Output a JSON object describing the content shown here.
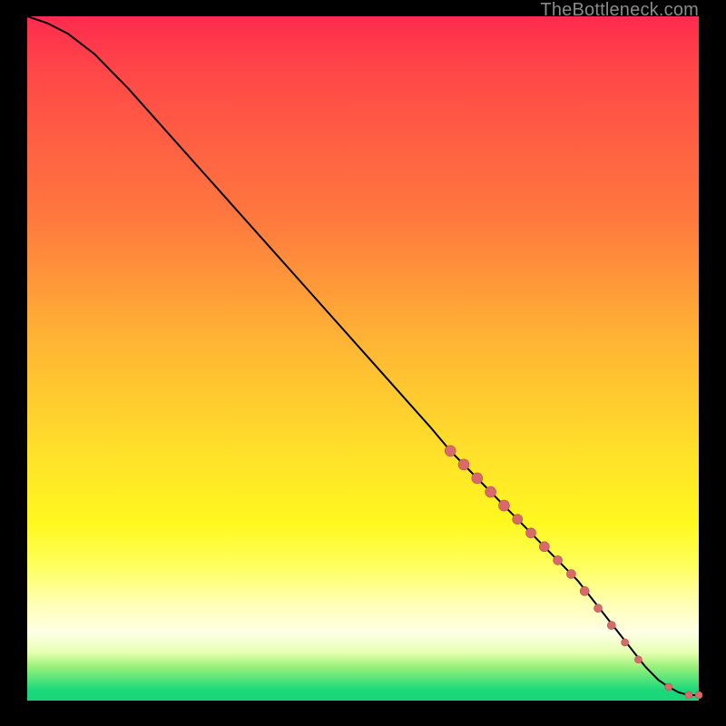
{
  "watermark": "TheBottleneck.com",
  "colors": {
    "marker_fill": "#d86a6a",
    "marker_stroke": "#b45252",
    "curve_stroke": "#000000"
  },
  "chart_data": {
    "type": "line",
    "title": "",
    "xlabel": "",
    "ylabel": "",
    "xlim": [
      0,
      100
    ],
    "ylim": [
      0,
      100
    ],
    "grid": false,
    "legend": false,
    "series": [
      {
        "name": "bottleneck-curve",
        "x": [
          0,
          3,
          6,
          10,
          15,
          20,
          25,
          30,
          35,
          40,
          45,
          50,
          55,
          60,
          63,
          65,
          68,
          70,
          72,
          74,
          76,
          78,
          80,
          82,
          84,
          86,
          88,
          90,
          92,
          94,
          95.5,
          97,
          98.5,
          100
        ],
        "y": [
          100,
          99,
          97.5,
          94.5,
          89.5,
          84,
          78.5,
          73,
          67.5,
          62,
          56.5,
          51,
          45.5,
          40,
          36.5,
          34.5,
          31.5,
          29.5,
          27.5,
          25.5,
          23.5,
          21.5,
          19.5,
          17.5,
          15,
          12.5,
          10,
          7.5,
          5,
          3,
          2,
          1.2,
          0.8,
          0.8
        ]
      }
    ],
    "markers": [
      {
        "x": 63,
        "y": 36.5,
        "r": 6
      },
      {
        "x": 65,
        "y": 34.5,
        "r": 6
      },
      {
        "x": 67,
        "y": 32.5,
        "r": 6
      },
      {
        "x": 69,
        "y": 30.5,
        "r": 6
      },
      {
        "x": 71,
        "y": 28.5,
        "r": 6
      },
      {
        "x": 73,
        "y": 26.5,
        "r": 5.5
      },
      {
        "x": 75,
        "y": 24.5,
        "r": 5.5
      },
      {
        "x": 77,
        "y": 22.5,
        "r": 5.5
      },
      {
        "x": 79,
        "y": 20.5,
        "r": 5
      },
      {
        "x": 81,
        "y": 18.5,
        "r": 5
      },
      {
        "x": 83,
        "y": 16,
        "r": 5
      },
      {
        "x": 85,
        "y": 13.5,
        "r": 4.5
      },
      {
        "x": 87,
        "y": 11,
        "r": 4.5
      },
      {
        "x": 89,
        "y": 8.5,
        "r": 4
      },
      {
        "x": 91,
        "y": 6,
        "r": 4
      },
      {
        "x": 95.5,
        "y": 2,
        "r": 4
      },
      {
        "x": 98.5,
        "y": 0.8,
        "r": 4
      },
      {
        "x": 100,
        "y": 0.8,
        "r": 4
      }
    ]
  }
}
